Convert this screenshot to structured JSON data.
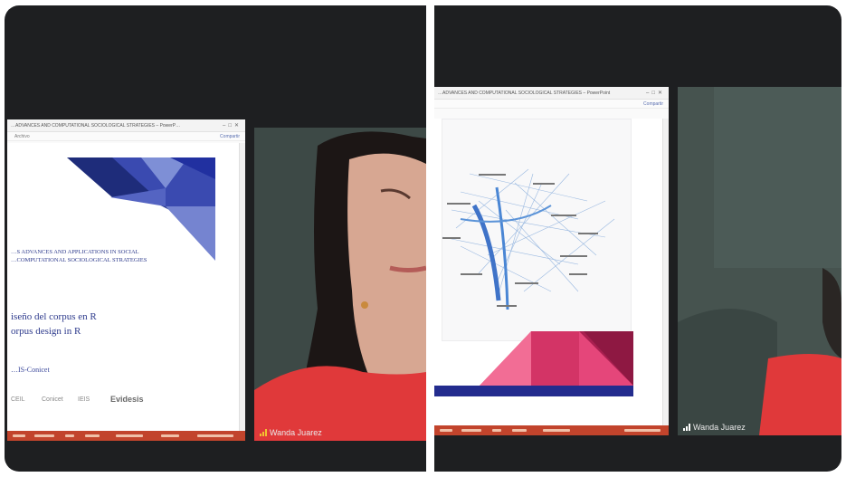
{
  "call": {
    "left_tile": {
      "window": {
        "title": "…ADVANCES AND COMPUTATIONAL SOCIOLOGICAL STRATEGIES – PowerP…",
        "ribbon_left": "Archivo",
        "ribbon_share": "Compartir"
      },
      "slide": {
        "title_line1": "…S ADVANCES AND APPLICATIONS IN SOCIAL",
        "title_line2": "…COMPUTATIONAL SOCIOLOGICAL STRATEGIES",
        "subtitle_line1": "iseño del corpus en R",
        "subtitle_line2": "orpus design in R",
        "authors": "…IS-Conicet",
        "logos": [
          "CEIL",
          "Conicet",
          "IEIS",
          "Evidesis"
        ]
      },
      "participant": {
        "name": "Wanda Juarez"
      }
    },
    "right_tile": {
      "window": {
        "title": "…ADVANCES AND COMPUTATIONAL SOCIOLOGICAL STRATEGIES – PowerPoint",
        "ribbon_share": "Compartir"
      },
      "participant": {
        "name": "Wanda Juarez"
      }
    }
  }
}
